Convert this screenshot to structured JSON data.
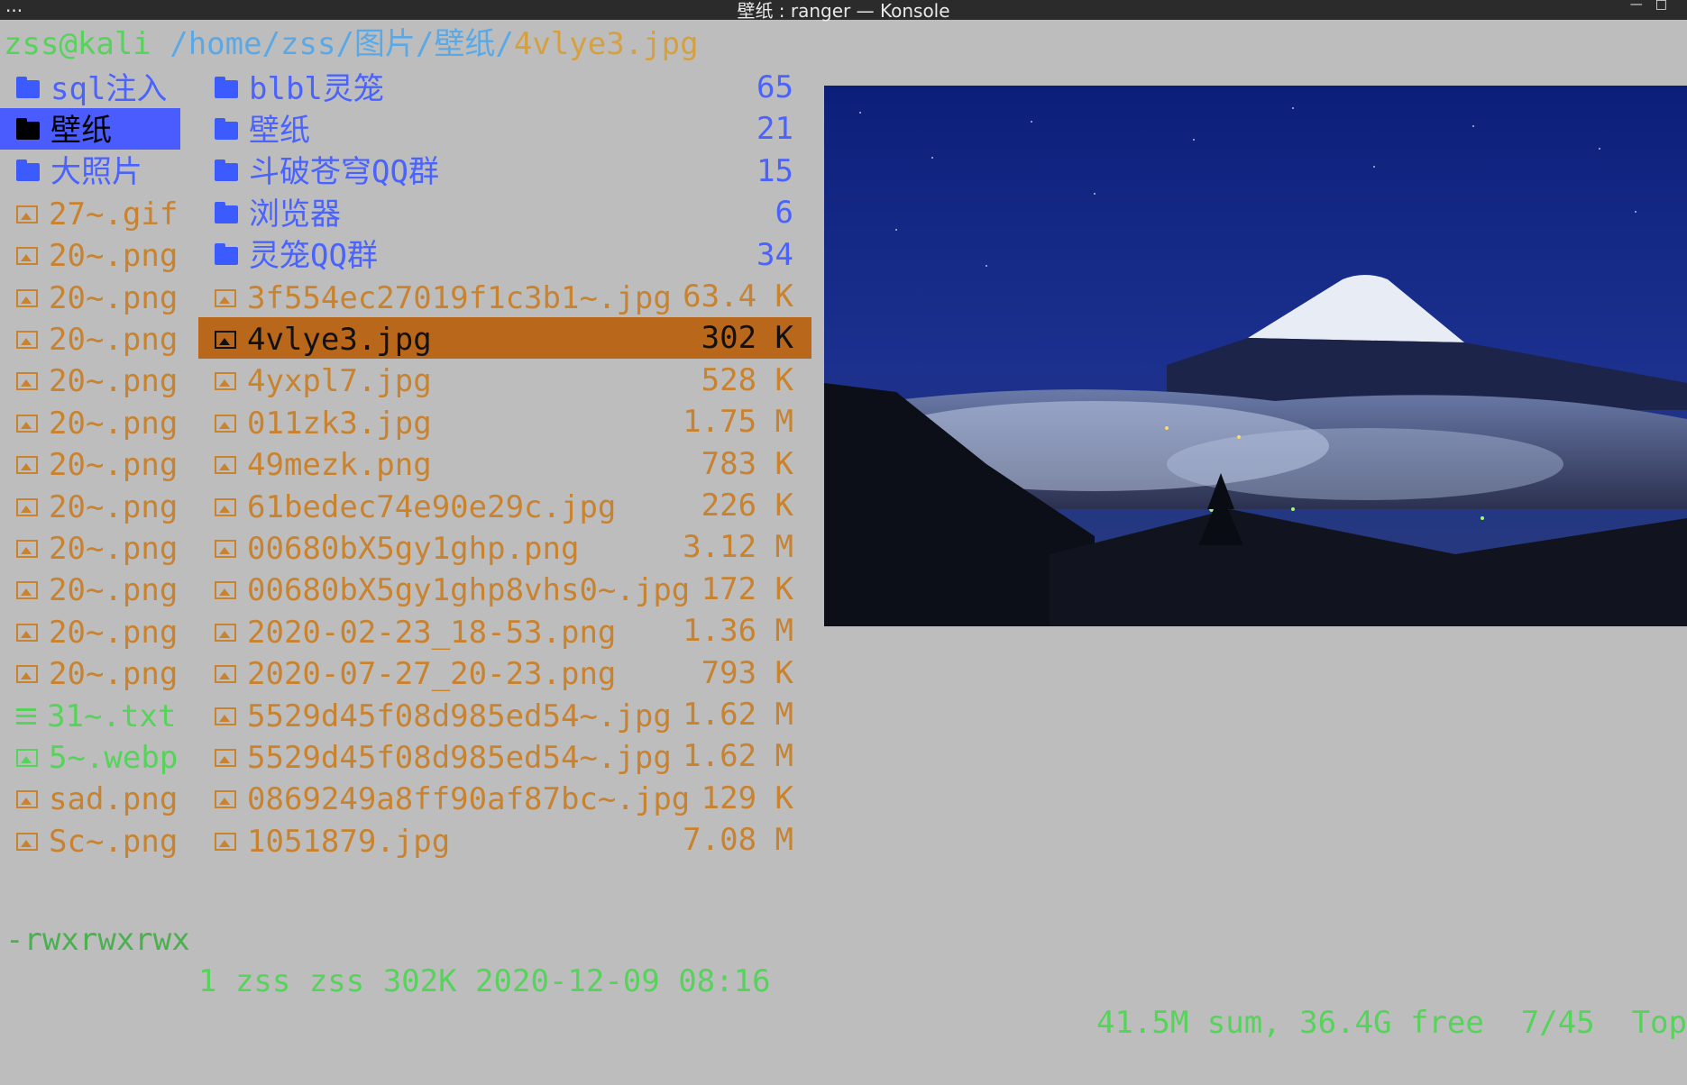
{
  "window": {
    "title": "壁纸 : ranger — Konsole",
    "menu_label": "..."
  },
  "path": {
    "host": "zss@kali",
    "dir": " /home/zss/图片/壁纸/",
    "file": "4vlye3.jpg"
  },
  "left_column": [
    {
      "type": "dir",
      "name": "sql注入"
    },
    {
      "type": "dir",
      "name": "壁纸",
      "selected": true
    },
    {
      "type": "dir",
      "name": "大照片"
    },
    {
      "type": "img",
      "name": "27~.gif"
    },
    {
      "type": "img",
      "name": "20~.png"
    },
    {
      "type": "img",
      "name": "20~.png"
    },
    {
      "type": "img",
      "name": "20~.png"
    },
    {
      "type": "img",
      "name": "20~.png"
    },
    {
      "type": "img",
      "name": "20~.png"
    },
    {
      "type": "img",
      "name": "20~.png"
    },
    {
      "type": "img",
      "name": "20~.png"
    },
    {
      "type": "img",
      "name": "20~.png"
    },
    {
      "type": "img",
      "name": "20~.png"
    },
    {
      "type": "img",
      "name": "20~.png"
    },
    {
      "type": "img",
      "name": "20~.png"
    },
    {
      "type": "txt",
      "name": "31~.txt"
    },
    {
      "type": "webp",
      "name": "5~.webp"
    },
    {
      "type": "img",
      "name": "sad.png"
    },
    {
      "type": "img",
      "name": "Sc~.png"
    }
  ],
  "file_list": [
    {
      "type": "dir",
      "name": "blbl灵笼",
      "size": "65"
    },
    {
      "type": "dir",
      "name": "壁纸",
      "size": "21"
    },
    {
      "type": "dir",
      "name": "斗破苍穹QQ群",
      "size": "15"
    },
    {
      "type": "dir",
      "name": "浏览器",
      "size": "6"
    },
    {
      "type": "dir",
      "name": "灵笼QQ群",
      "size": "34"
    },
    {
      "type": "img",
      "name": "3f554ec27019f1c3b1~.jpg",
      "size": "63.4 K"
    },
    {
      "type": "img",
      "name": "4vlye3.jpg",
      "size": "302 K",
      "selected": true
    },
    {
      "type": "img",
      "name": "4yxpl7.jpg",
      "size": "528 K"
    },
    {
      "type": "img",
      "name": "011zk3.jpg",
      "size": "1.75 M"
    },
    {
      "type": "img",
      "name": "49mezk.png",
      "size": "783 K"
    },
    {
      "type": "img",
      "name": "61bedec74e90e29c.jpg",
      "size": "226 K"
    },
    {
      "type": "img",
      "name": "00680bX5gy1ghp.png",
      "size": "3.12 M"
    },
    {
      "type": "img",
      "name": "00680bX5gy1ghp8vhs0~.jpg",
      "size": "172 K"
    },
    {
      "type": "img",
      "name": "2020-02-23_18-53.png",
      "size": "1.36 M"
    },
    {
      "type": "img",
      "name": "2020-07-27_20-23.png",
      "size": "793 K"
    },
    {
      "type": "img",
      "name": "5529d45f08d985ed54~.jpg",
      "size": "1.62 M"
    },
    {
      "type": "img",
      "name": "5529d45f08d985ed54~.jpg",
      "size": "1.62 M"
    },
    {
      "type": "img",
      "name": "0869249a8ff90af87bc~.jpg",
      "size": "129 K"
    },
    {
      "type": "img",
      "name": "1051879.jpg",
      "size": "7.08 M"
    }
  ],
  "status": {
    "perm": "-rwxrwxrwx",
    "info": "1 zss zss 302K 2020-12-09 08:16",
    "right": "41.5M sum, 36.4G free  7/45  Top"
  },
  "colors": {
    "dir": "#4a63ff",
    "img": "#c9822e",
    "txt": "#55d35a",
    "selection_left": "#4b5cff",
    "selection_right": "#b9671a"
  }
}
